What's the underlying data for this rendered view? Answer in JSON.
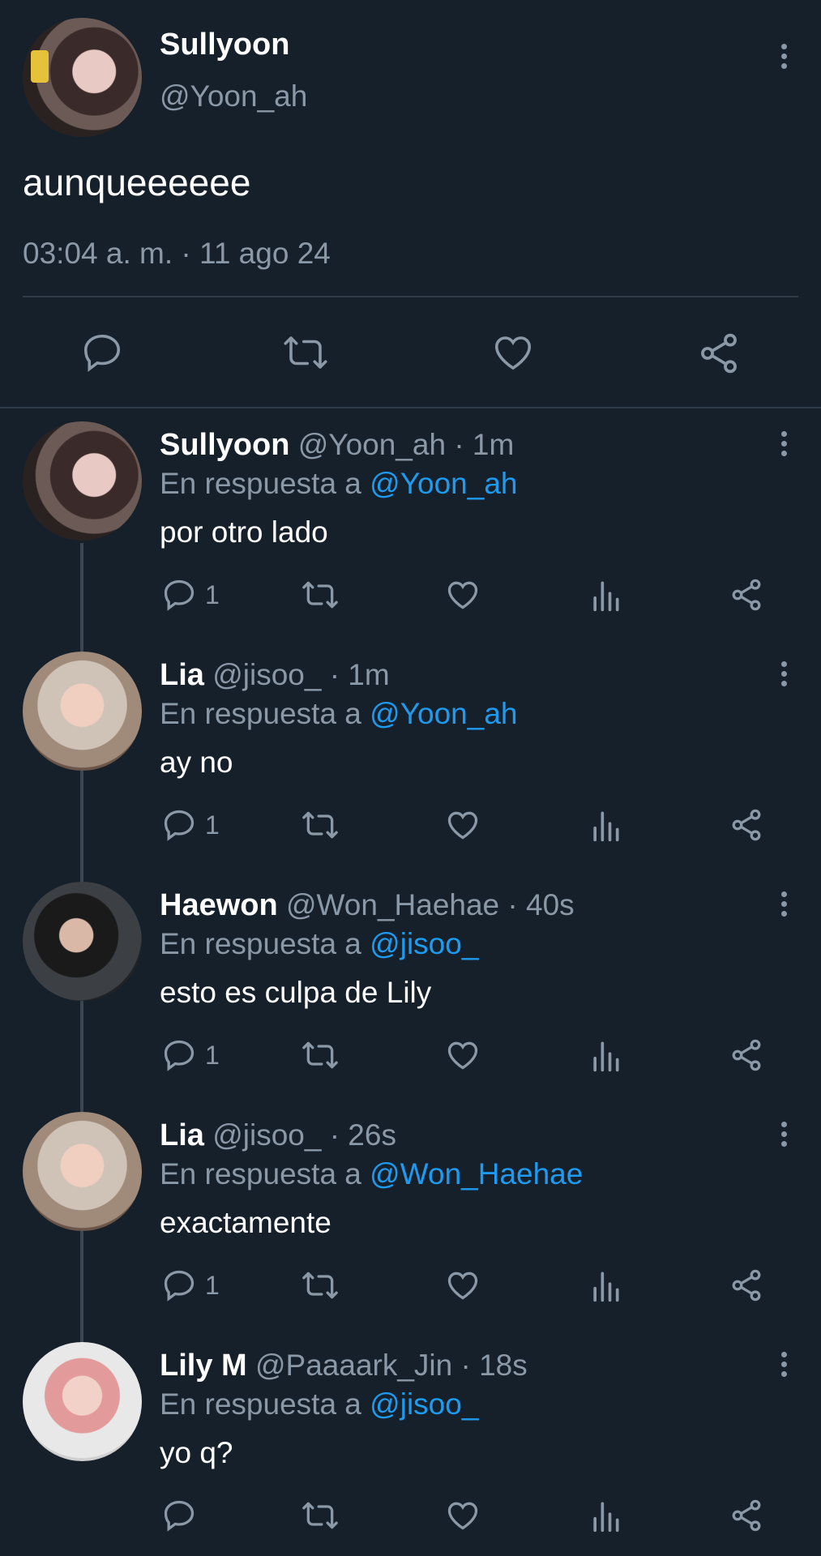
{
  "main_tweet": {
    "display_name": "Sullyoon",
    "handle": "@Yoon_ah",
    "text": "aunqueeeeee",
    "timestamp": "03:04 a. m. · 11 ago 24"
  },
  "replies": [
    {
      "display_name": "Sullyoon",
      "handle": "@Yoon_ah",
      "time": "· 1m",
      "reply_prefix": "En respuesta a",
      "reply_to": "@Yoon_ah",
      "text": "por otro lado",
      "reply_count": "1"
    },
    {
      "display_name": "Lia",
      "handle": "@jisoo_",
      "time": "· 1m",
      "reply_prefix": "En respuesta a",
      "reply_to": "@Yoon_ah",
      "text": "ay no",
      "reply_count": "1"
    },
    {
      "display_name": "Haewon",
      "handle": "@Won_Haehae",
      "time": "· 40s",
      "reply_prefix": "En respuesta a",
      "reply_to": "@jisoo_",
      "text": "esto es culpa de Lily",
      "reply_count": "1"
    },
    {
      "display_name": "Lia",
      "handle": "@jisoo_",
      "time": "· 26s",
      "reply_prefix": "En respuesta a",
      "reply_to": "@Won_Haehae",
      "text": "exactamente",
      "reply_count": "1"
    },
    {
      "display_name": "Lily M",
      "handle": "@Paaaark_Jin",
      "time": "· 18s",
      "reply_prefix": "En respuesta a",
      "reply_to": "@jisoo_",
      "text": "yo q?",
      "reply_count": ""
    }
  ],
  "colors": {
    "background": "#16202b",
    "accent": "#1d9bf0",
    "muted": "#8b98a5",
    "text": "#ffffff",
    "divider": "#2f3b47"
  },
  "icons": {
    "reply": "reply-icon",
    "retweet": "retweet-icon",
    "like": "like-icon",
    "views": "views-icon",
    "share": "share-icon",
    "more": "more-icon"
  }
}
